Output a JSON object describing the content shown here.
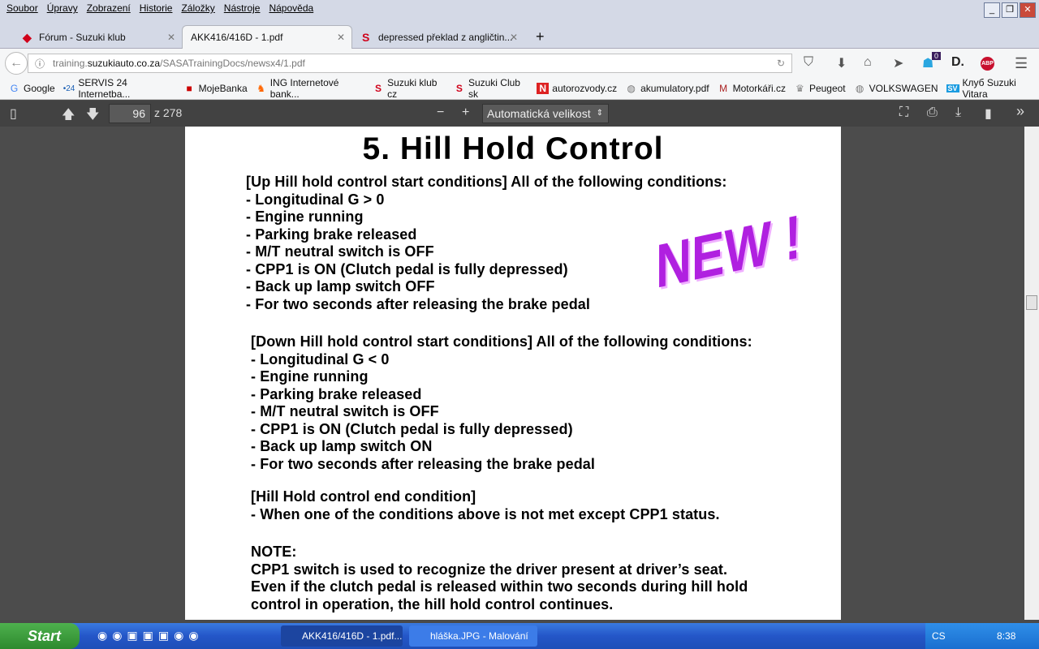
{
  "menu": [
    "Soubor",
    "Úpravy",
    "Zobrazení",
    "Historie",
    "Záložky",
    "Nástroje",
    "Nápověda"
  ],
  "tabs": [
    {
      "label": "Fórum - Suzuki klub",
      "active": false
    },
    {
      "label": "AKK416/416D - 1.pdf",
      "active": true
    },
    {
      "label": "depressed překlad z angličtin...",
      "active": false
    }
  ],
  "url": {
    "pre": "training.",
    "domain": "suzukiauto.co.za",
    "path": "/SASATrainingDocs/newsx4/1.pdf"
  },
  "toolbar": {
    "badge": "0",
    "abp": "ABP",
    "d": "D."
  },
  "bookmarks": [
    {
      "icon": "G",
      "label": "Google"
    },
    {
      "icon": "•24",
      "label": "SERVIS 24 Internetba..."
    },
    {
      "icon": "■",
      "label": "MojeBanka"
    },
    {
      "icon": "♞",
      "label": "ING Internetové bank..."
    },
    {
      "icon": "S",
      "label": "Suzuki klub cz"
    },
    {
      "icon": "S",
      "label": "Suzuki Club sk"
    },
    {
      "icon": "N",
      "label": "autorozvody.cz"
    },
    {
      "icon": "◍",
      "label": "akumulatory.pdf"
    },
    {
      "icon": "M",
      "label": "Motorkáři.cz"
    },
    {
      "icon": "♛",
      "label": "Peugeot"
    },
    {
      "icon": "◍",
      "label": "VOLKSWAGEN"
    },
    {
      "icon": "SV",
      "label": "Клуб Suzuki Vitara"
    }
  ],
  "pdf": {
    "page": "96",
    "of": "z 278",
    "zoom": "Automatická velikost"
  },
  "doc": {
    "title": "5. Hill Hold Control",
    "art": "NEW !",
    "lines": [
      "[Up Hill hold control start conditions] All of the following conditions:",
      "- Longitudinal G > 0",
      "- Engine running",
      "- Parking brake released",
      "- M/T neutral switch is OFF",
      "- CPP1 is ON (Clutch pedal is fully depressed)",
      "- Back up lamp switch OFF",
      "- For two seconds after releasing the brake pedal",
      "[Down Hill hold control start conditions] All of the following conditions:",
      "- Longitudinal G < 0",
      "- Engine running",
      "- Parking brake released",
      "- M/T neutral switch is OFF",
      "- CPP1 is ON (Clutch pedal is fully depressed)",
      "- Back up lamp switch ON",
      "- For two seconds after releasing the brake pedal",
      "[Hill Hold control end condition]",
      "- When one of the conditions above is not met except CPP1 status.",
      "NOTE:",
      "CPP1 switch is used to recognize the driver present at driver’s seat.",
      "Even if the clutch pedal is released within two seconds during hill hold",
      "control in operation, the hill hold control continues."
    ]
  },
  "taskbar": {
    "start": "Start",
    "tasks": [
      "AKK416/416D - 1.pdf...",
      "hláška.JPG - Malování"
    ],
    "lang": "CS",
    "time": "8:38"
  }
}
